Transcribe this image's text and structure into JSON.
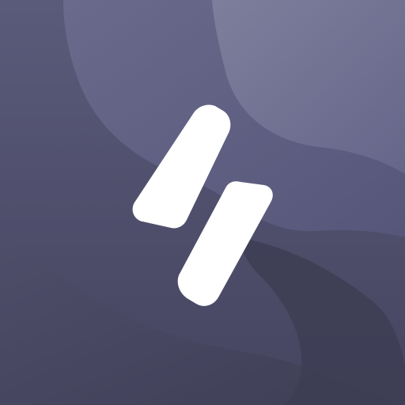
{
  "icon": {
    "name": "app-logo-icon",
    "colors": {
      "base": "#575775",
      "wave_light": "#7a7a98",
      "wave_mid": "#66668a",
      "wave_dark": "#44445c",
      "wave_darkest": "#3c3c52",
      "glyph": "#ffffff"
    }
  }
}
